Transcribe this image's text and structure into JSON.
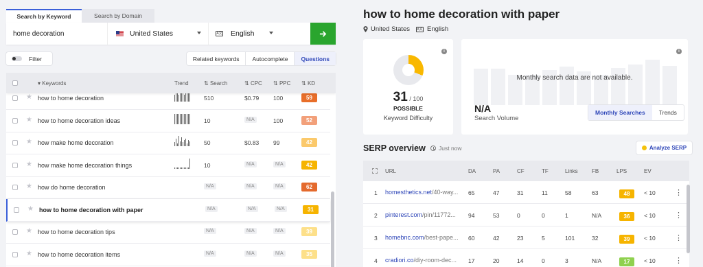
{
  "tabs": {
    "by_keyword": "Search by Keyword",
    "by_domain": "Search by Domain"
  },
  "search": {
    "query": "home decoration",
    "country": "United States",
    "language": "English",
    "lang_icon": "A文"
  },
  "filter": {
    "label": "Filter"
  },
  "keyword_tabs": {
    "related": "Related keywords",
    "autocomplete": "Autocomplete",
    "questions": "Questions"
  },
  "table": {
    "headers": {
      "keywords": "Keywords",
      "trend": "Trend",
      "search": "Search",
      "cpc": "CPC",
      "ppc": "PPC",
      "kd": "KD"
    },
    "na": "N/A",
    "rows": [
      {
        "keyword": "how to home decoration",
        "trend": [
          6,
          7,
          7,
          6,
          8,
          7,
          9,
          6,
          8,
          7,
          9,
          8
        ],
        "search": "510",
        "cpc": "$0.79",
        "ppc": "100",
        "kd": "59",
        "kd_color": "#e86e2a"
      },
      {
        "keyword": "how to home decoration ideas",
        "trend": [
          10,
          10,
          10,
          10,
          10,
          10,
          10,
          10,
          10,
          10,
          10,
          10
        ],
        "search": "10",
        "cpc": "N/A",
        "ppc": "100",
        "kd": "52",
        "kd_color": "#f2a07a"
      },
      {
        "keyword": "how make home decoration",
        "trend": [
          3,
          6,
          2,
          8,
          4,
          7,
          3,
          5,
          6,
          2,
          5,
          4
        ],
        "search": "50",
        "cpc": "$0.83",
        "ppc": "99",
        "kd": "42",
        "kd_color": "#fbc96b"
      },
      {
        "keyword": "how make home decoration things",
        "trend": [
          1,
          1,
          1,
          1,
          1,
          1,
          1,
          1,
          1,
          1,
          1,
          10
        ],
        "search": "10",
        "cpc": "N/A",
        "ppc": "N/A",
        "kd": "42",
        "kd_color": "#f6b400"
      },
      {
        "keyword": "how do home decoration",
        "trend": [],
        "search": "N/A",
        "cpc": "N/A",
        "ppc": "N/A",
        "kd": "62",
        "kd_color": "#e46a2d"
      },
      {
        "keyword": "how to home decoration with paper",
        "trend": [],
        "search": "N/A",
        "cpc": "N/A",
        "ppc": "N/A",
        "kd": "31",
        "kd_color": "#f6b400"
      },
      {
        "keyword": "how to home decoration tips",
        "trend": [],
        "search": "N/A",
        "cpc": "N/A",
        "ppc": "N/A",
        "kd": "39",
        "kd_color": "#fde08a"
      },
      {
        "keyword": "how to home decoration items",
        "trend": [],
        "search": "N/A",
        "cpc": "N/A",
        "ppc": "N/A",
        "kd": "35",
        "kd_color": "#fde08a"
      }
    ]
  },
  "detail": {
    "title": "how to home decoration with paper",
    "country": "United States",
    "language": "English",
    "kd": {
      "value": "31",
      "max": "/ 100",
      "rating": "POSSIBLE",
      "label": "Keyword Difficulty",
      "percent": 31
    },
    "volume": {
      "message": "Monthly search data are not available.",
      "value": "N/A",
      "label": "Search Volume",
      "tab_monthly": "Monthly Searches",
      "tab_trends": "Trends"
    }
  },
  "serp": {
    "title": "SERP overview",
    "time": "Just now",
    "analyze_label": "Analyze SERP",
    "headers": {
      "url": "URL",
      "da": "DA",
      "pa": "PA",
      "cf": "CF",
      "tf": "TF",
      "links": "Links",
      "fb": "FB",
      "lps": "LPS",
      "ev": "EV"
    },
    "rows": [
      {
        "n": "1",
        "domain": "homesthetics.net",
        "path": "/40-way...",
        "da": "65",
        "pa": "47",
        "cf": "31",
        "tf": "11",
        "links": "58",
        "fb": "63",
        "lps": "48",
        "lps_color": "#f6b400",
        "ev": "< 10"
      },
      {
        "n": "2",
        "domain": "pinterest.com",
        "path": "/pin/11772...",
        "da": "94",
        "pa": "53",
        "cf": "0",
        "tf": "0",
        "links": "1",
        "fb": "N/A",
        "lps": "36",
        "lps_color": "#f6b400",
        "ev": "< 10"
      },
      {
        "n": "3",
        "domain": "homebnc.com",
        "path": "/best-pape...",
        "da": "60",
        "pa": "42",
        "cf": "23",
        "tf": "5",
        "links": "101",
        "fb": "32",
        "lps": "39",
        "lps_color": "#f6b400",
        "ev": "< 10"
      },
      {
        "n": "4",
        "domain": "cradiori.co",
        "path": "/diy-room-dec...",
        "da": "17",
        "pa": "20",
        "cf": "14",
        "tf": "0",
        "links": "3",
        "fb": "N/A",
        "lps": "17",
        "lps_color": "#8fd14f",
        "ev": "< 10"
      }
    ]
  }
}
